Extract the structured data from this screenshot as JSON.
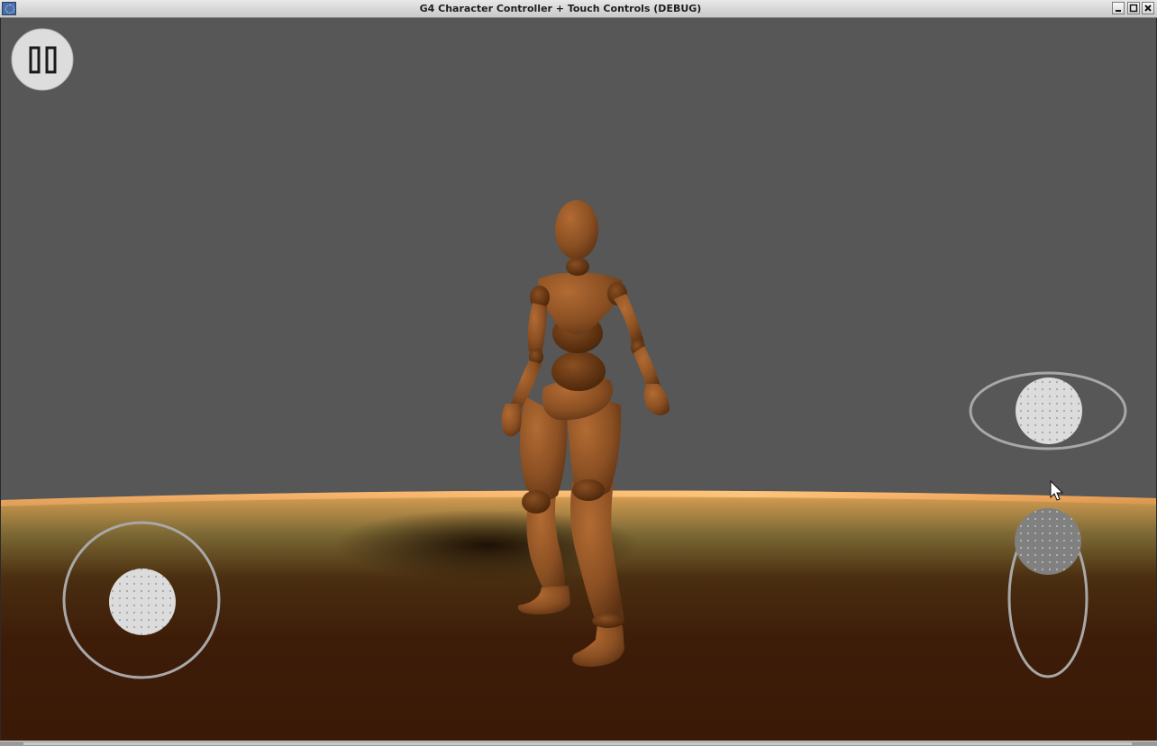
{
  "window": {
    "title": "G4 Character Controller + Touch Controls (DEBUG)",
    "icon": "app-icon",
    "controls": [
      "minimize-icon",
      "maximize-icon",
      "close-icon"
    ]
  },
  "scene": {
    "sky_color": "#575757",
    "ground_horizon_glow": "#f0a050",
    "ground_color": "#3f1d08",
    "character_color": "#8a4f22",
    "character": "wooden-mannequin"
  },
  "hud": {
    "pause_button": {
      "icon": "pause-icon"
    },
    "move_joystick": {
      "icon": "joystick-knob"
    },
    "look_joystick": {
      "icon": "horizontal-joystick-knob"
    },
    "vertical_slider": {
      "icon": "vertical-joystick-knob"
    },
    "cursor": {
      "icon": "mouse-cursor-icon"
    }
  },
  "colors": {
    "hud_ring": "#a8a8a8",
    "hud_knob_light": "#d8d8d8",
    "hud_knob_dark": "#7f7f7f"
  }
}
